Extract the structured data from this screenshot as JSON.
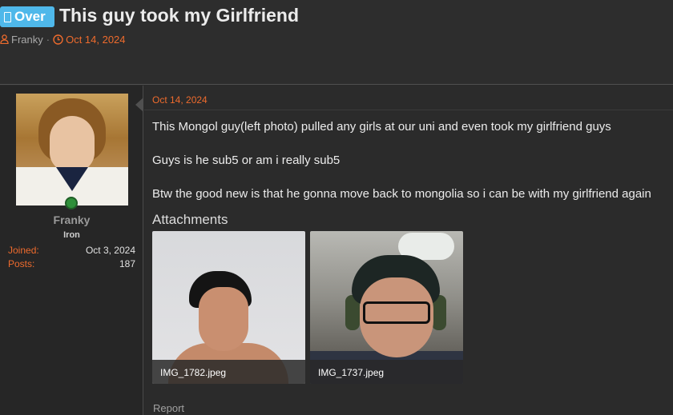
{
  "thread": {
    "prefix_label": "Over",
    "title": "This guy took my Girlfriend",
    "author": "Franky",
    "separator": "·",
    "date": "Oct 14, 2024"
  },
  "user": {
    "name": "Franky",
    "rank": "Iron",
    "stats": [
      {
        "label": "Joined:",
        "value": "Oct 3, 2024"
      },
      {
        "label": "Posts:",
        "value": "187"
      }
    ]
  },
  "message": {
    "date": "Oct 14, 2024",
    "lines": [
      "This Mongol guy(left photo) pulled any girls at our uni and even took my girlfriend guys",
      "Guys is he sub5 or am i really sub5",
      "Btw the good new is that he gonna move back to mongolia so i can be with my girlfriend again"
    ],
    "attachments_heading": "Attachments",
    "attachments": [
      {
        "filename": "IMG_1782.jpeg"
      },
      {
        "filename": "IMG_1737.jpeg"
      }
    ],
    "report_label": "Report"
  },
  "colors": {
    "accent": "#ee6b2d",
    "badge": "#4fb8ea",
    "background": "#2b2b2b"
  }
}
